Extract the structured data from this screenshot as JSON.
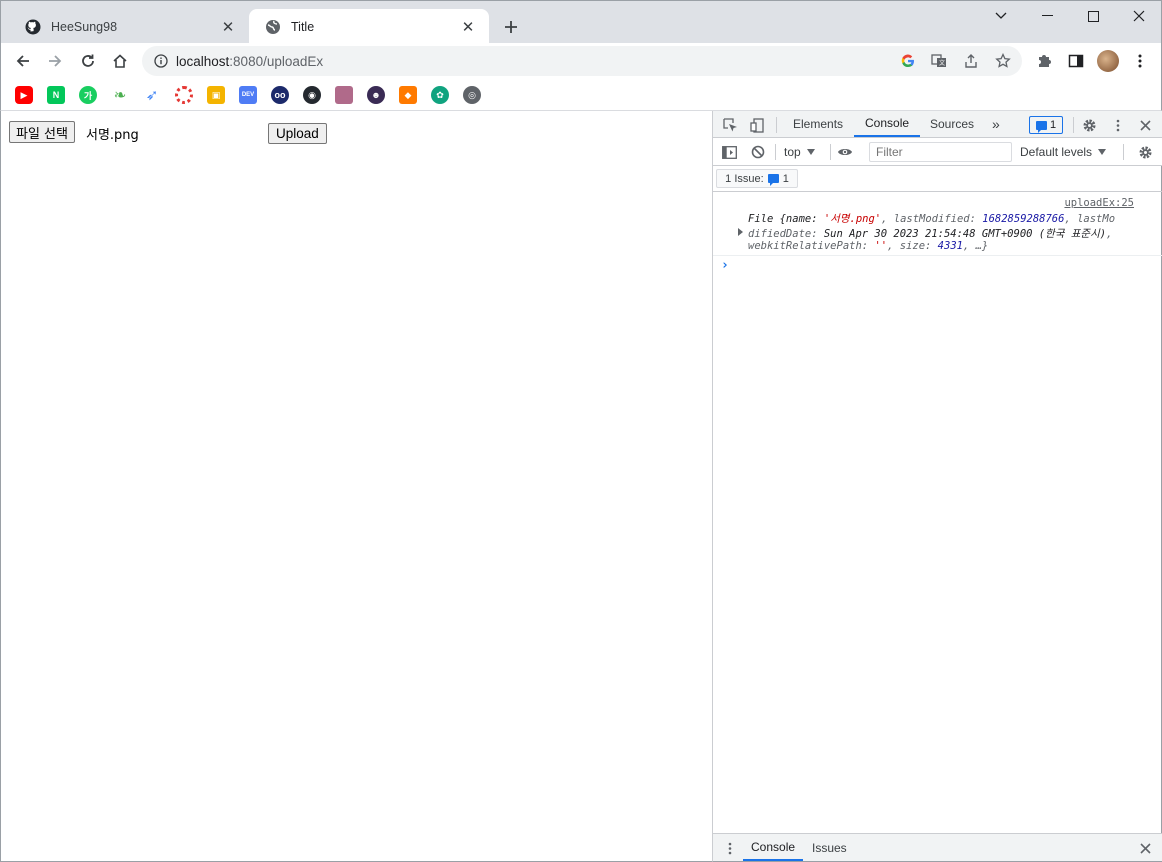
{
  "tabs": [
    {
      "title": "HeeSung98",
      "favicon": "github-icon",
      "active": false
    },
    {
      "title": "Title",
      "favicon": "globe-icon",
      "active": true
    }
  ],
  "address": {
    "host": "localhost",
    "path": ":8080/uploadEx"
  },
  "bookmarks": [
    "youtube-icon",
    "naver-icon",
    "papago-icon",
    "leaf-icon",
    "feather-icon",
    "ring-icon",
    "photo-icon",
    "dev-icon",
    "owl-icon",
    "github-icon",
    "avatar-icon",
    "anime-icon",
    "box-icon",
    "openai-icon",
    "globe-icon"
  ],
  "page": {
    "file_button": "파일 선택",
    "file_name": "서명.png",
    "upload_button": "Upload"
  },
  "devtools": {
    "tabs": [
      "Elements",
      "Console",
      "Sources"
    ],
    "active_tab": "Console",
    "more": "»",
    "issues_count": "1",
    "context": "top",
    "filter_placeholder": "Filter",
    "levels": "Default levels",
    "issues_chip_label": "1 Issue:",
    "issues_chip_count": "1",
    "message": {
      "source": "uploadEx:25",
      "line1_prefix": "File {name: ",
      "name_val": "'서명.png'",
      "line1_mid": ", lastModified: ",
      "lastmod_val": "1682859288766",
      "line1_end": ", lastMo",
      "line2_start": "difiedDate: ",
      "date_val": "Sun Apr 30 2023 21:54:48 GMT+0900 (한국 표준시)",
      "line2_end": ",",
      "line3_key": "webkitRelativePath: ",
      "path_val": "''",
      "line3_mid": ", size: ",
      "size_val": "4331",
      "line3_end": ", …}"
    },
    "prompt": "›",
    "drawer_tabs": [
      "Console",
      "Issues"
    ]
  }
}
